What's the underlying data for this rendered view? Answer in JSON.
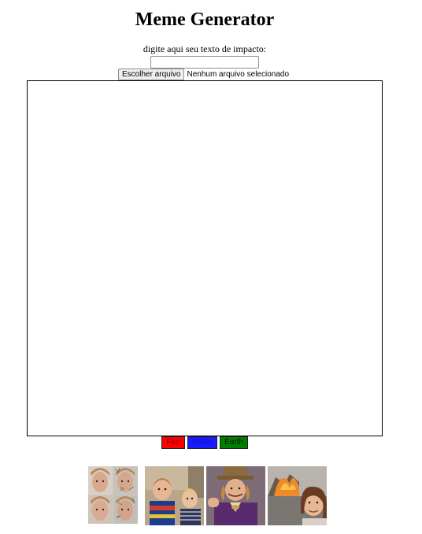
{
  "page": {
    "title": "Meme Generator"
  },
  "form": {
    "prompt_label": "digite aqui seu texto de impacto:",
    "text_value": "",
    "file_button_label": "Escolher arquivo",
    "file_status": "Nenhum arquivo selecionado"
  },
  "color_buttons": [
    {
      "label": "Fire",
      "color": "#ff0000"
    },
    {
      "label": "Water",
      "color": "#1a1aff"
    },
    {
      "label": "Earth",
      "color": "#008000"
    }
  ],
  "templates": [
    {
      "icon": "four-panel-face-meme-thumbnail"
    },
    {
      "icon": "two-kids-meme-thumbnail"
    },
    {
      "icon": "willy-wonka-meme-thumbnail"
    },
    {
      "icon": "disaster-girl-meme-thumbnail"
    }
  ]
}
